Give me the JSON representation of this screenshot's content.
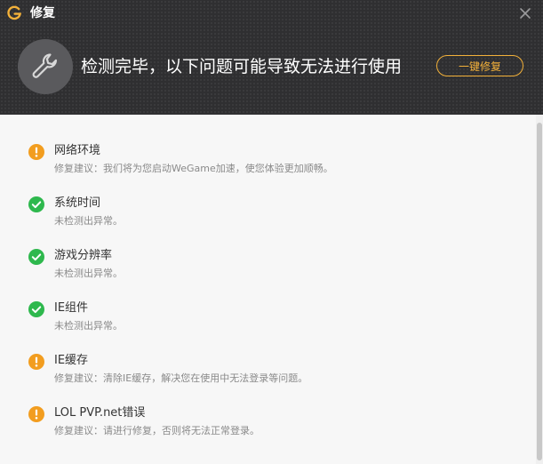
{
  "window": {
    "title": "修复"
  },
  "header": {
    "headline": "检测完毕，以下问题可能导致无法进行使用",
    "fix_button_label": "一键修复"
  },
  "colors": {
    "accent": "#f3b13a",
    "warning": "#f29d1f",
    "ok": "#2eb84d",
    "header_bg": "#2f2f31"
  },
  "items": [
    {
      "status": "warning",
      "icon": "warning-icon",
      "title": "网络环境",
      "desc": "修复建议：我们将为您启动WeGame加速，使您体验更加顺畅。"
    },
    {
      "status": "ok",
      "icon": "check-icon",
      "title": "系统时间",
      "desc": "未检测出异常。"
    },
    {
      "status": "ok",
      "icon": "check-icon",
      "title": "游戏分辨率",
      "desc": "未检测出异常。"
    },
    {
      "status": "ok",
      "icon": "check-icon",
      "title": "IE组件",
      "desc": "未检测出异常。"
    },
    {
      "status": "warning",
      "icon": "warning-icon",
      "title": "IE缓存",
      "desc": "修复建议：清除IE缓存，解决您在使用中无法登录等问题。"
    },
    {
      "status": "warning",
      "icon": "warning-icon",
      "title": "LOL PVP.net错误",
      "desc": "修复建议：请进行修复，否则将无法正常登录。"
    }
  ]
}
